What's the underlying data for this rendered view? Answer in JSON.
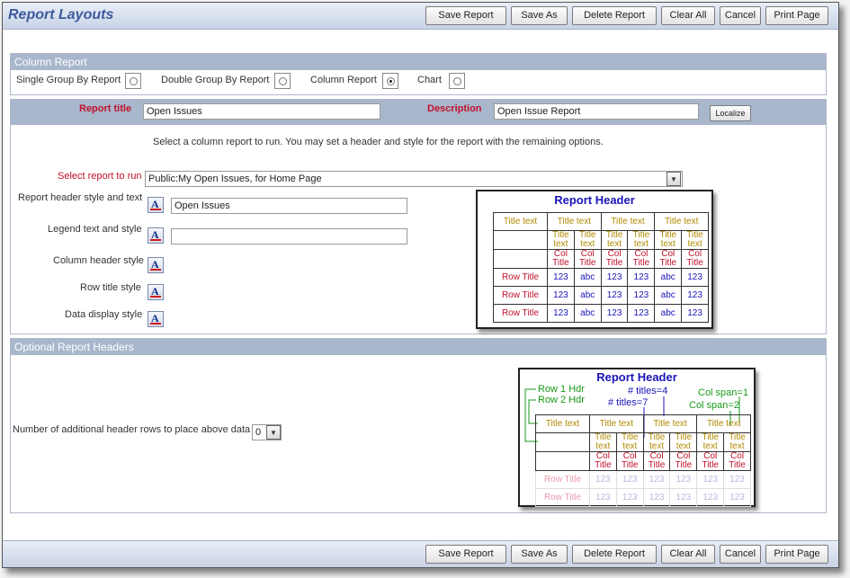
{
  "app": {
    "title": "Report Layouts"
  },
  "toolbar": {
    "save_report": "Save Report",
    "save_as": "Save As",
    "delete_report": "Delete Report",
    "clear_all": "Clear All",
    "cancel": "Cancel",
    "print_page": "Print Page"
  },
  "column_report": {
    "header": "Column Report",
    "options": [
      {
        "label": "Single Group By Report",
        "selected": false
      },
      {
        "label": "Double Group By Report",
        "selected": false
      },
      {
        "label": "Column Report",
        "selected": true
      },
      {
        "label": "Chart",
        "selected": false
      }
    ]
  },
  "report": {
    "title_label": "Report title",
    "title_value": "Open Issues",
    "description_label": "Description",
    "description_value": "Open Issue Report",
    "localize": "Localize",
    "instructions": "Select a column report to run. You may set a header and style for the report with the remaining options.",
    "select_label": "Select report to run",
    "select_value": "Public:My Open Issues, for Home Page",
    "header_style_label": "Report header style and text",
    "header_text": "Open Issues",
    "legend_label": "Legend text and style",
    "legend_text": "",
    "column_header_label": "Column header style",
    "row_title_label": "Row title style",
    "data_display_label": "Data display style"
  },
  "preview1": {
    "header": "Report Header",
    "title_text": "Title text",
    "sub_title": "Title text",
    "col_title": "Col Title",
    "row_title": "Row Title",
    "num": "123",
    "abc": "abc"
  },
  "optional": {
    "header": "Optional Report Headers",
    "rows_label": "Number of additional header rows to place above data",
    "rows_value": "0"
  },
  "preview2": {
    "header": "Report Header",
    "row1": "Row 1 Hdr",
    "row2": "Row 2 Hdr",
    "titles4": "# titles=4",
    "titles7": "# titles=7",
    "span1": "Col span=1",
    "span2": "Col span=2",
    "title_text": "Title text",
    "sub_title": "Title text",
    "col_title": "Col Title",
    "row_title": "Row Title",
    "num": "123"
  },
  "colors": {
    "accent": "#3d5a9c",
    "section": "#a9b7cd",
    "label_red": "#c0102a"
  }
}
